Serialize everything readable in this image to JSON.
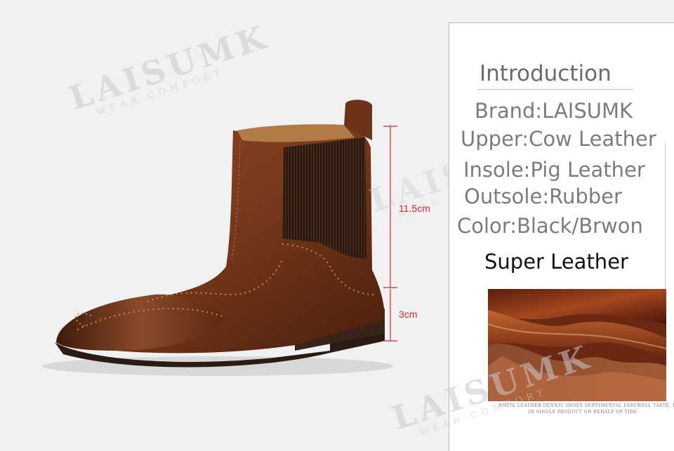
{
  "brand_watermark": {
    "name": "LAISUMK",
    "tagline": "WEAR COMFORT"
  },
  "dimensions": {
    "shaft_height": "11.5cm",
    "heel_height": "3cm",
    "marker_color": "#d62a2a"
  },
  "introduction": {
    "title": "Introduction",
    "specs": [
      "Brand:LAISUMK",
      "Upper:Cow Leather",
      "Insole:Pig Leather",
      "Outsole:Rubber",
      "Color:Black/Brwon"
    ]
  },
  "super_leather": {
    "title": "Super Leather",
    "caption_lines": [
      "WHITE LEATHER DENNIS SHOES SENTIMENTAL FAREWELL TASTE, IS",
      "IN SINGLE PRODUCT ON BEHALF OF TIDE"
    ]
  },
  "colors": {
    "leather": "#7a3a1c",
    "leather_dark": "#4a1f0d",
    "elastic": "#3e2418",
    "sole": "#2a1b14",
    "background": "#f1f1f1"
  }
}
